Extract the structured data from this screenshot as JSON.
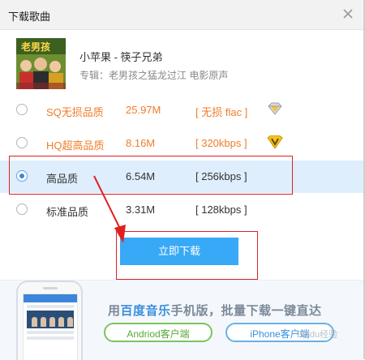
{
  "dialog": {
    "title": "下载歌曲",
    "close_icon": "close-icon"
  },
  "song": {
    "title": "小苹果 - 筷子兄弟",
    "album_label": "专辑：",
    "album_name": "老男孩之猛龙过江 电影原声",
    "cover_text": "老男孩"
  },
  "options": [
    {
      "name": "SQ无损品质",
      "size": "25.97M",
      "format": "[ 无损 flac ]",
      "selected": false,
      "badge": "diamond-badge-icon",
      "color": "#f07c28"
    },
    {
      "name": "HQ超高品质",
      "size": "8.16M",
      "format": "[ 320kbps ]",
      "selected": false,
      "badge": "vip-v-badge-icon",
      "color": "#f07c28"
    },
    {
      "name": "高品质",
      "size": "6.54M",
      "format": "[ 256kbps ]",
      "selected": true,
      "badge": null,
      "color": "#333333"
    },
    {
      "name": "标准品质",
      "size": "3.31M",
      "format": "[ 128kbps ]",
      "selected": false,
      "badge": null,
      "color": "#333333"
    }
  ],
  "download_button": "立即下载",
  "promo": {
    "prefix": "用",
    "highlight": "百度音乐",
    "suffix": "手机版，批量下载一键直达",
    "android_label": "Andriod客户端",
    "iphone_label": "iPhone客户端",
    "watermark": "Baidu经验"
  },
  "colors": {
    "accent": "#38a9f6",
    "orange": "#f07c28",
    "annotation_red": "#e02020",
    "selected_row": "#deeefc"
  }
}
